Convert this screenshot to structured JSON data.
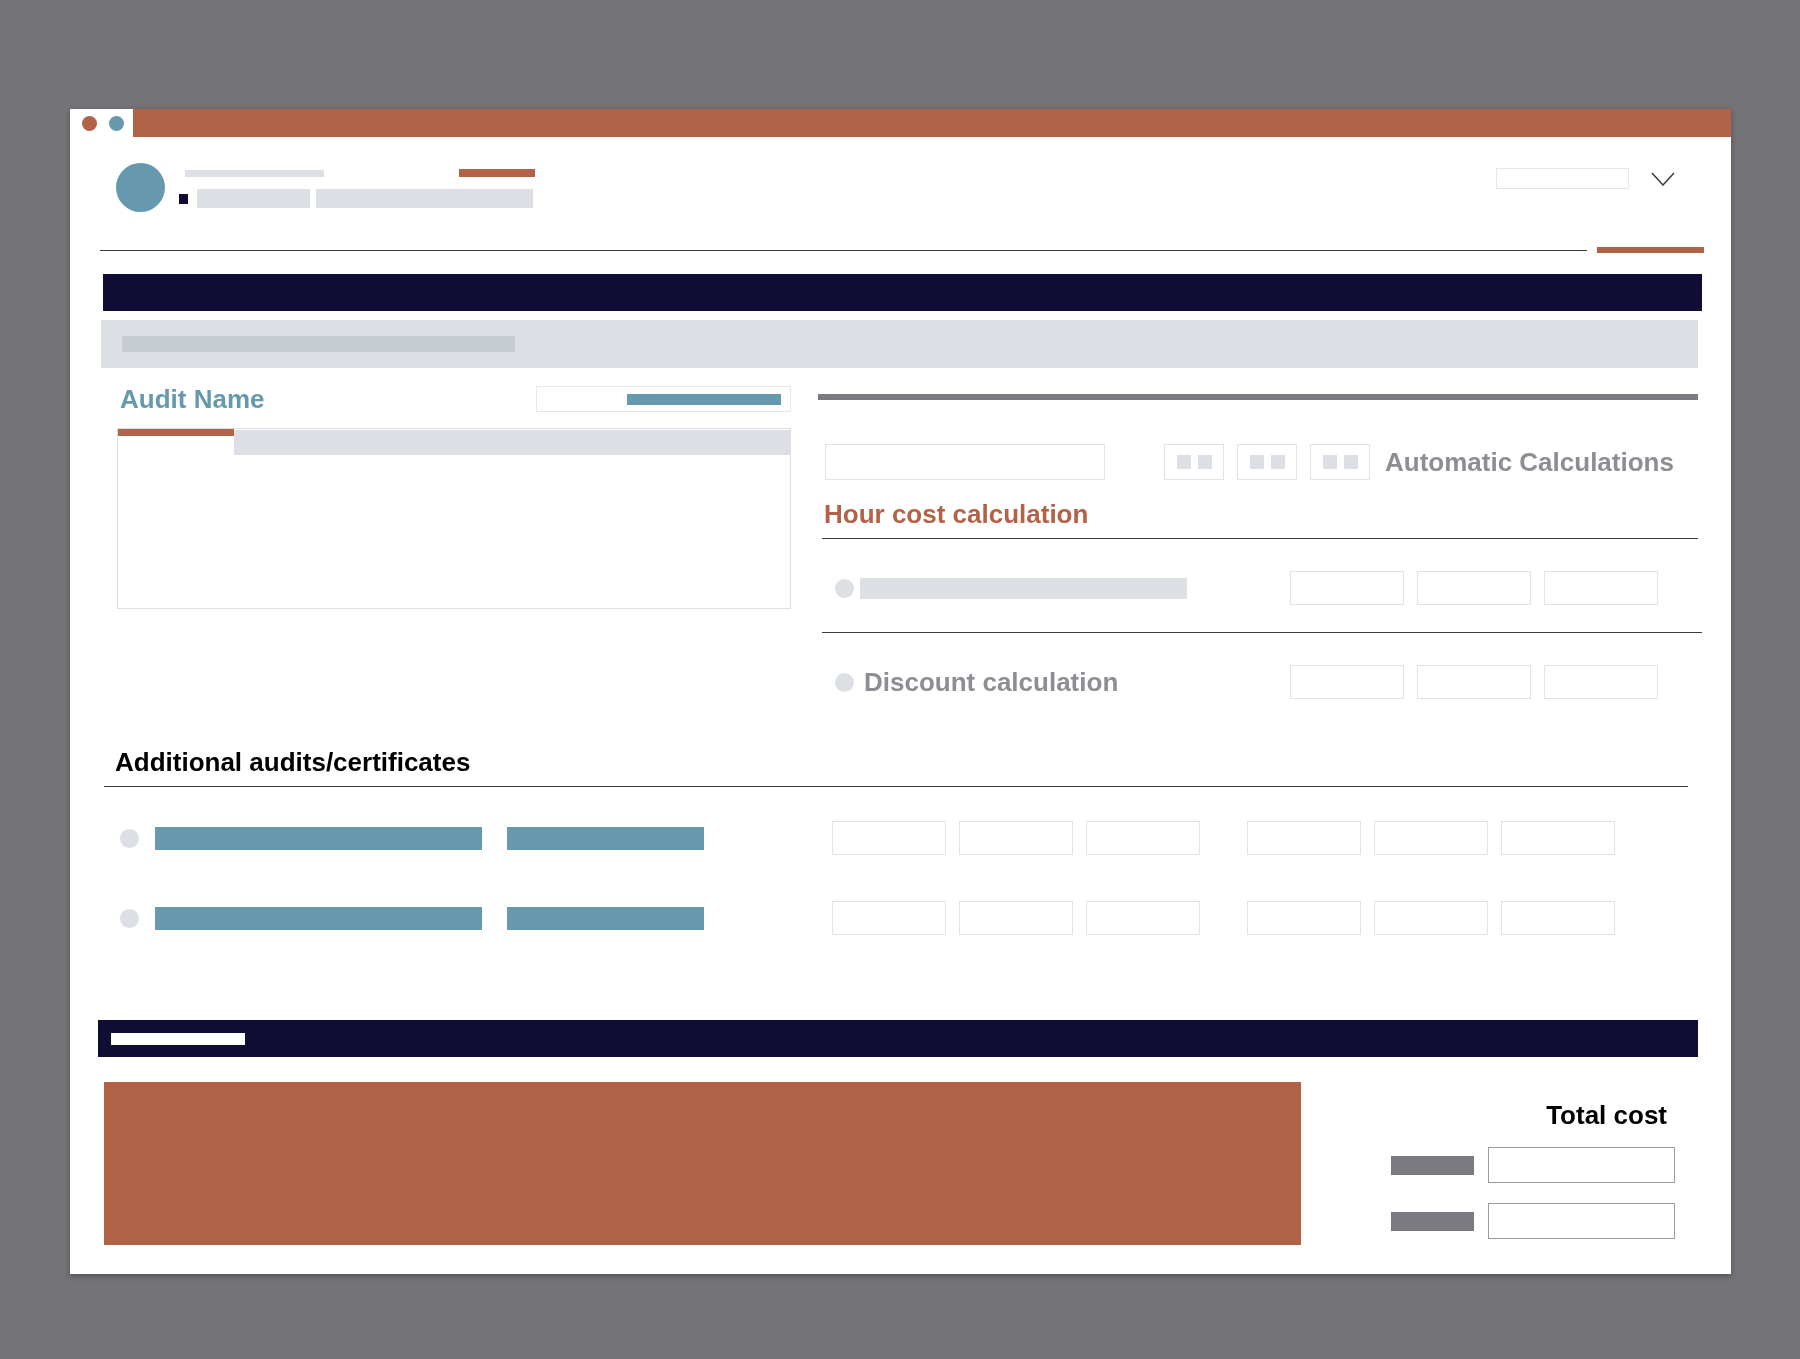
{
  "audit": {
    "title": "Audit Name"
  },
  "calculations": {
    "automatic_label": "Automatic Calculations",
    "heading": "Hour cost calculation",
    "rows": [
      {
        "kind": "placeholder",
        "selected": false
      },
      {
        "kind": "text",
        "label": "Discount calculation",
        "selected": false
      }
    ]
  },
  "additional": {
    "heading": "Additional audits/certificates",
    "rows": [
      {
        "selected": false
      },
      {
        "selected": false
      }
    ]
  },
  "total": {
    "heading": "Total cost"
  }
}
